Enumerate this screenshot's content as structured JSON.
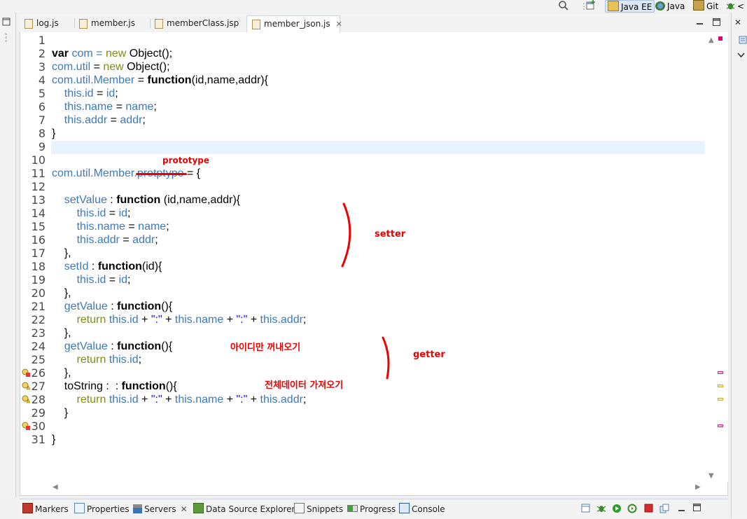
{
  "toolbar": {
    "perspectives": [
      {
        "label": "Java EE",
        "active": true
      },
      {
        "label": "Java",
        "active": false
      },
      {
        "label": "Git",
        "active": false
      },
      {
        "label": "<",
        "active": false
      }
    ]
  },
  "tabs": [
    {
      "label": "log.js",
      "active": false
    },
    {
      "label": "member.js",
      "active": false
    },
    {
      "label": "memberClass.jsp",
      "active": false
    },
    {
      "label": "member_json.js",
      "active": true
    }
  ],
  "tab_close_glyph": "✕",
  "line_numbers": [
    "1",
    "2",
    "3",
    "4",
    "5",
    "6",
    "7",
    "8",
    "9",
    "10",
    "11",
    "12",
    "13",
    "14",
    "15",
    "16",
    "17",
    "18",
    "19",
    "20",
    "21",
    "22",
    "23",
    "24",
    "25",
    "26",
    "27",
    "28",
    "29",
    "30",
    "31"
  ],
  "code": {
    "l2": {
      "kw": "var",
      "a": " com = ",
      "b": "new",
      "c": " Object();"
    },
    "l3": {
      "a": "com.util",
      "b": " = ",
      "c": "new",
      "d": " Object();"
    },
    "l4": {
      "a": "com.util.Member",
      "b": " = ",
      "c": "function",
      "d": "(id,name,addr){"
    },
    "l5": {
      "a": "this.id",
      "b": " = ",
      "c": "id",
      "d": ";"
    },
    "l6": {
      "a": "this.name",
      "b": " = ",
      "c": "name",
      "d": ";"
    },
    "l7": {
      "a": "this.addr",
      "b": " = ",
      "c": "addr",
      "d": ";"
    },
    "l8": "}",
    "l11": {
      "a": "com.util.Member.",
      "b": "protptype",
      "c": " = {"
    },
    "l13": {
      "a": "setValue",
      "b": " : ",
      "c": "function",
      "d": " (id,name,addr){"
    },
    "l14": {
      "a": "this.id",
      "b": " = ",
      "c": "id",
      "d": ";"
    },
    "l15": {
      "a": "this.name",
      "b": " = ",
      "c": "name",
      "d": ";"
    },
    "l16": {
      "a": "this.addr",
      "b": " = ",
      "c": "addr",
      "d": ";"
    },
    "l17": "},",
    "l18": {
      "a": "setId",
      "b": " : ",
      "c": "function",
      "d": "(id){"
    },
    "l19": {
      "a": "this.id",
      "b": " = ",
      "c": "id",
      "d": ";"
    },
    "l20": "},",
    "l21": {
      "a": "getValue",
      "b": " : ",
      "c": "function",
      "d": "(){"
    },
    "l22": {
      "ret": "return",
      "a": "this.id",
      "s1": "\":\"",
      "b": "this.name",
      "s2": "\":\"",
      "c": "this.addr",
      "d": ";"
    },
    "l23": "},",
    "l24": {
      "a": "getValue",
      "b": " : ",
      "c": "function",
      "d": "(){"
    },
    "l25": {
      "ret": "return",
      "a": "this.id",
      "d": ";"
    },
    "l26": "},",
    "l27": {
      "a": "toString",
      "b": " :  : ",
      "c": "function",
      "d": "(){"
    },
    "l28": {
      "ret": "return",
      "a": "this.id",
      "s1": "\":\"",
      "b": "this.name",
      "s2": "\":\"",
      "c": "this.addr",
      "d": ";"
    },
    "l29": "}",
    "l31": "}"
  },
  "annotations": {
    "prototype": "prototype",
    "setter": "setter",
    "getter": "getter",
    "id_only": "아이디만 꺼내오기",
    "all_data": "전체데이터 가져오기"
  },
  "colors": {
    "annotation": "#e00000",
    "identifier": "#3c7ab9",
    "current_line": "#e8f2fe"
  },
  "bottom_tabs": [
    "Markers",
    "Properties",
    "Servers",
    "Data Source Explorer",
    "Snippets",
    "Progress",
    "Console"
  ]
}
